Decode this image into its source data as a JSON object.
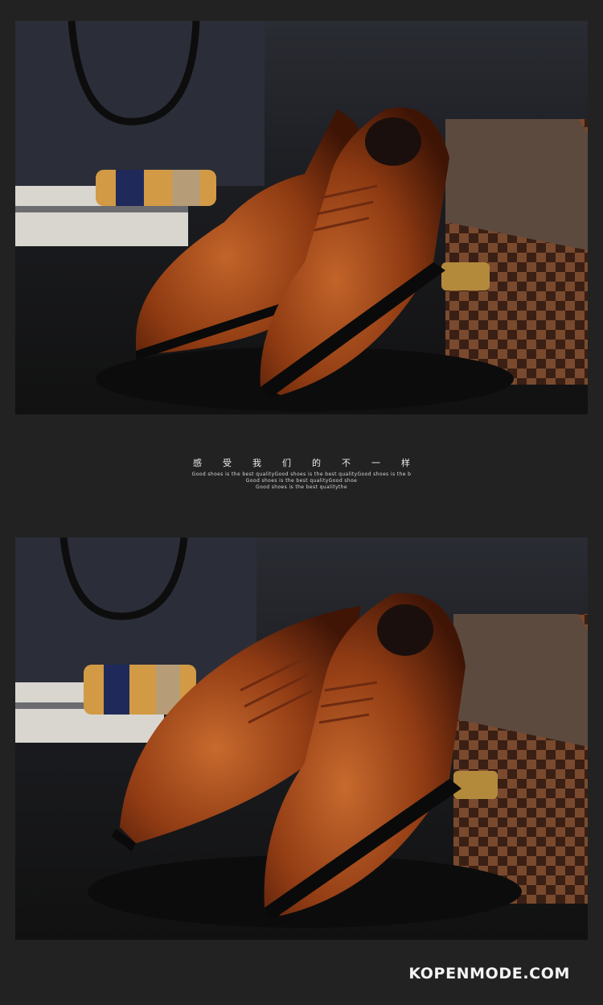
{
  "product_photos": [
    {
      "id": "top",
      "subject": "brown-brogue-shoes-pair-with-suitcase"
    },
    {
      "id": "bottom",
      "subject": "brown-brogue-shoes-pair-angled"
    }
  ],
  "caption": {
    "headline": "感受我们的不一样",
    "lines": [
      "Good shoes is the best qualityGood shoes is the best qualityGood shoes is the b",
      "Good shoes is the best qualityGood shoe",
      "Good shoes is the best qualitythe"
    ]
  },
  "watermark": "KOPENMODE.COM",
  "colors": {
    "background": "#222222",
    "leather": "#8e3a12",
    "checker_dark": "#3a1f14",
    "checker_light": "#7a4a2e"
  }
}
